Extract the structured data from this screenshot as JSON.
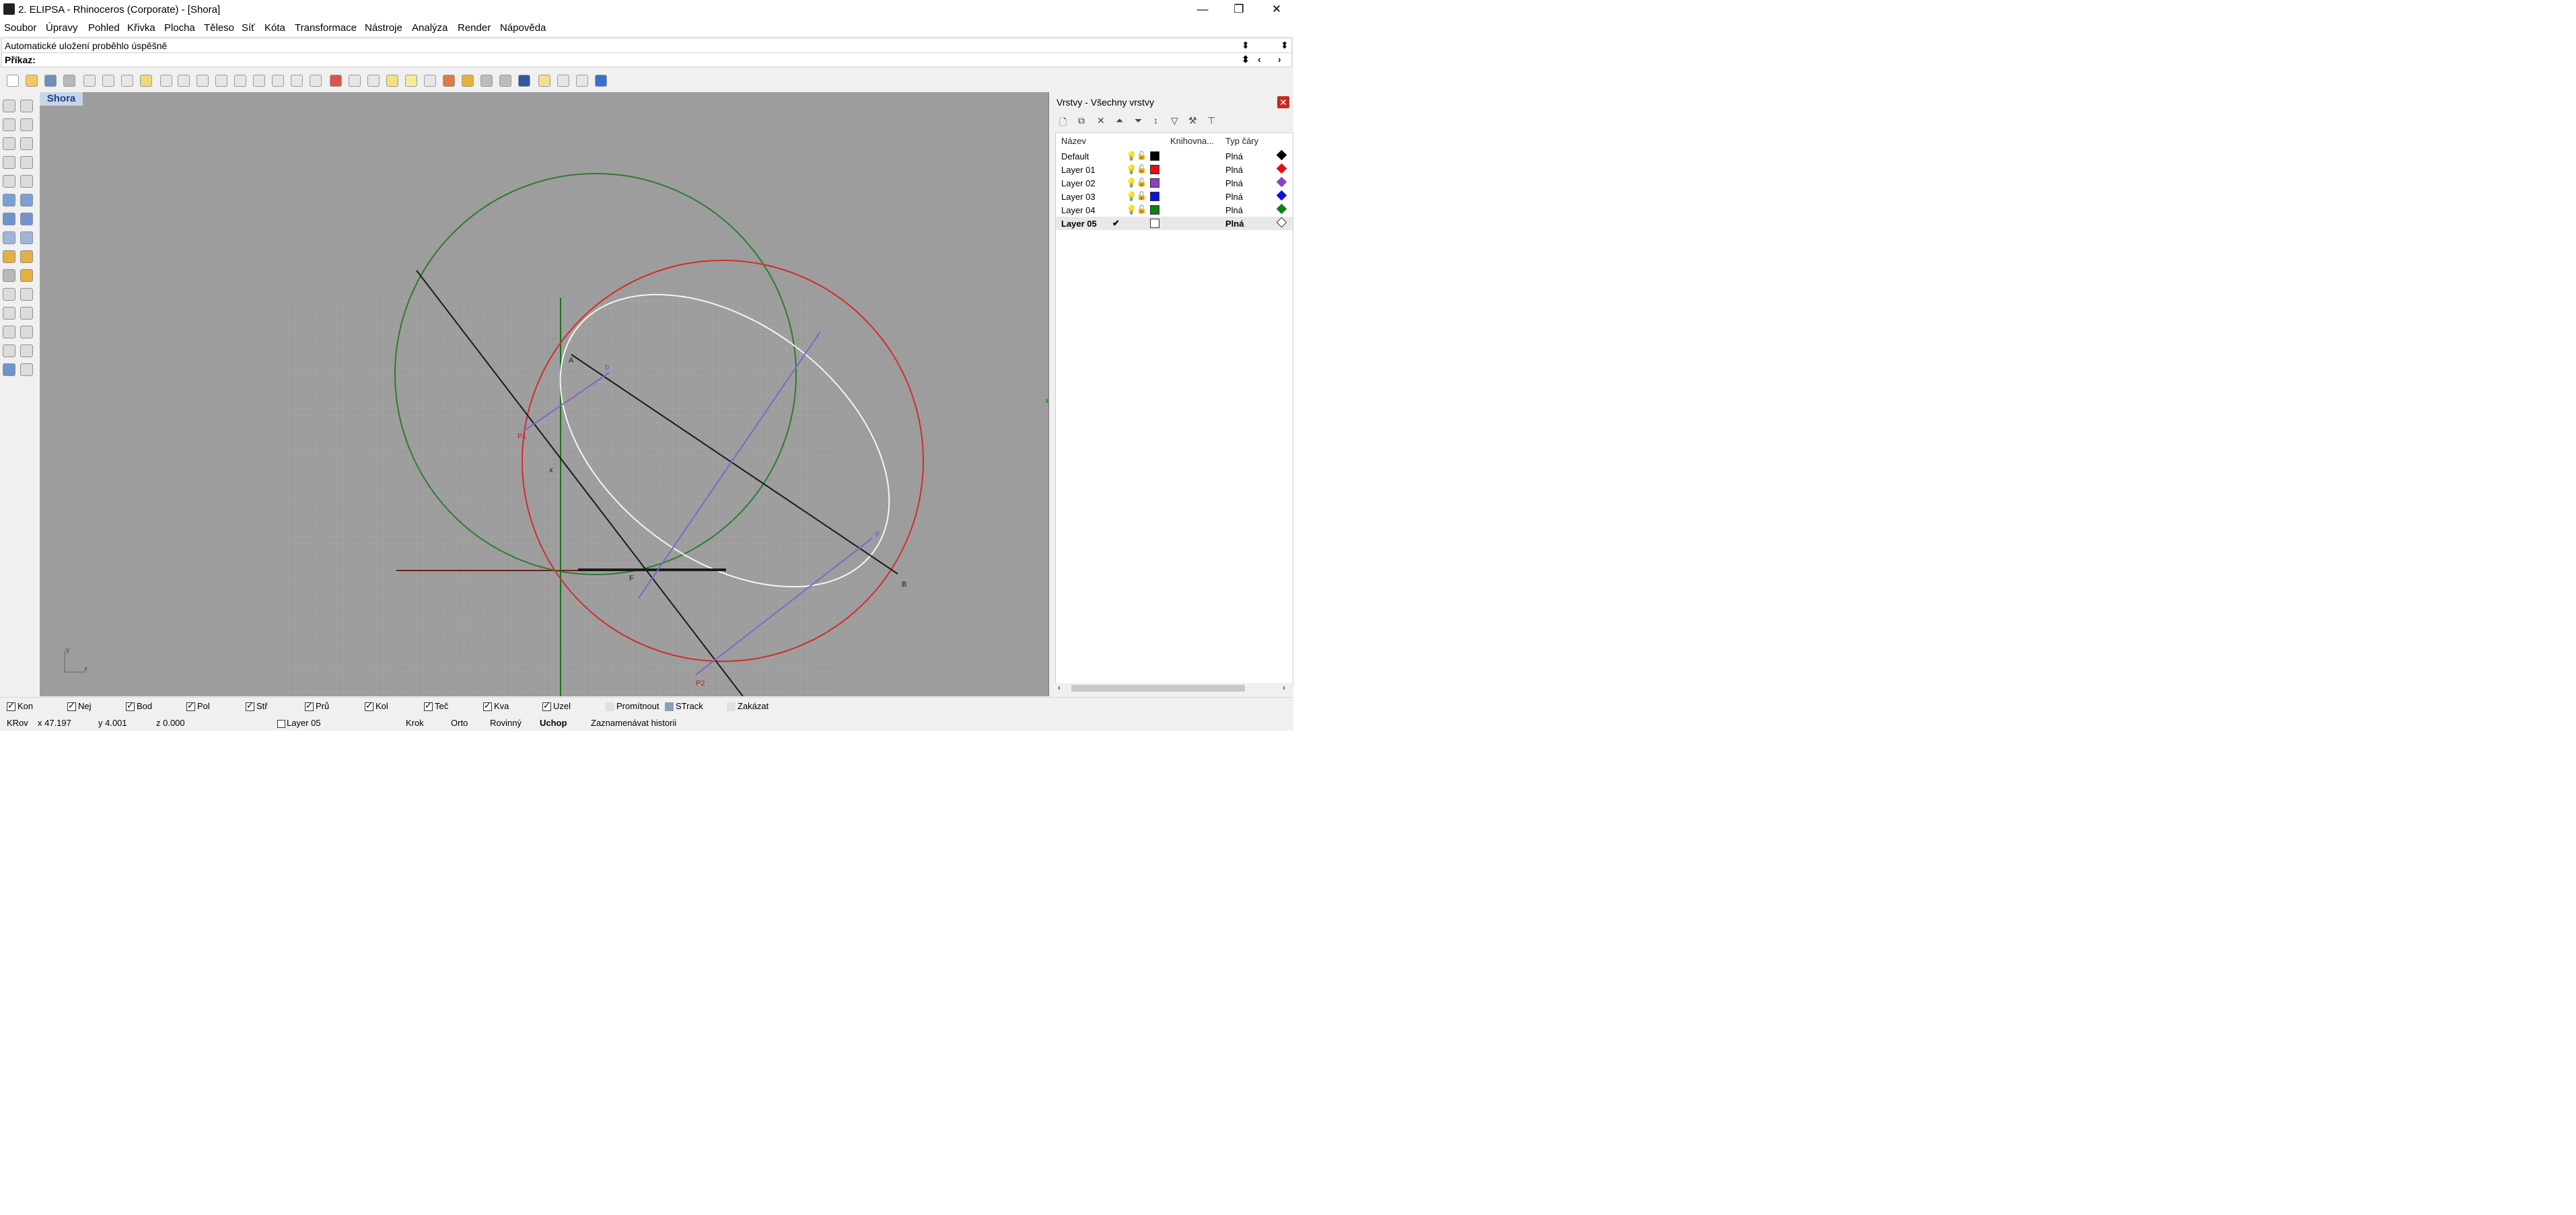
{
  "window": {
    "title": "2. ELIPSA - Rhinoceros (Corporate) - [Shora]",
    "minimize": "—",
    "restore": "❐",
    "close": "✕"
  },
  "menu": [
    "Soubor",
    "Úpravy",
    "Pohled",
    "Křivka",
    "Plocha",
    "Těleso",
    "Síť",
    "Kóta",
    "Transformace",
    "Nástroje",
    "Analýza",
    "Render",
    "Nápověda"
  ],
  "statusline": "Automatické uložení proběhlo úspěšně",
  "command": {
    "label": "Příkaz:",
    "value": ""
  },
  "viewport": {
    "tab": "Shora",
    "labels": {
      "A": "A",
      "B": "B",
      "P1": "P1",
      "P2": "P2",
      "F": "F",
      "F2": "F",
      "b": "b",
      "x": "x"
    },
    "axis_y": "y",
    "axis_x": "x"
  },
  "layers_panel": {
    "title": "Vrstvy - Všechny vrstvy",
    "columns": [
      "Název",
      "Knihovna...",
      "Typ čáry"
    ],
    "layers": [
      {
        "name": "Default",
        "color": "#000000",
        "linetype": "Plná",
        "current": false
      },
      {
        "name": "Layer 01",
        "color": "#e01010",
        "linetype": "Plná",
        "current": false
      },
      {
        "name": "Layer 02",
        "color": "#9040c0",
        "linetype": "Plná",
        "current": false
      },
      {
        "name": "Layer 03",
        "color": "#1010e0",
        "linetype": "Plná",
        "current": false
      },
      {
        "name": "Layer 04",
        "color": "#108010",
        "linetype": "Plná",
        "current": false
      },
      {
        "name": "Layer 05",
        "color": "#ffffff",
        "linetype": "Plná",
        "current": true,
        "check": "✔"
      }
    ]
  },
  "osnaps": [
    {
      "label": "Kon",
      "checked": true
    },
    {
      "label": "Nej",
      "checked": true
    },
    {
      "label": "Bod",
      "checked": true
    },
    {
      "label": "Pol",
      "checked": true
    },
    {
      "label": "Stř",
      "checked": true
    },
    {
      "label": "Prů",
      "checked": true
    },
    {
      "label": "Kol",
      "checked": true
    },
    {
      "label": "Teč",
      "checked": true
    },
    {
      "label": "Kva",
      "checked": true
    },
    {
      "label": "Uzel",
      "checked": true
    },
    {
      "label": "Promítnout",
      "checked": false
    },
    {
      "label": "STrack",
      "checked": false
    },
    {
      "label": "Zakázat",
      "checked": false
    }
  ],
  "statusbar": {
    "cplane": "KRov",
    "x": "x 47.197",
    "y": "y 4.001",
    "z": "z 0.000",
    "layer": "Layer 05",
    "grid_snap": "Krok",
    "ortho": "Orto",
    "planar": "Rovinný",
    "osnap": "Uchop",
    "history": "Zaznamenávat historii"
  }
}
